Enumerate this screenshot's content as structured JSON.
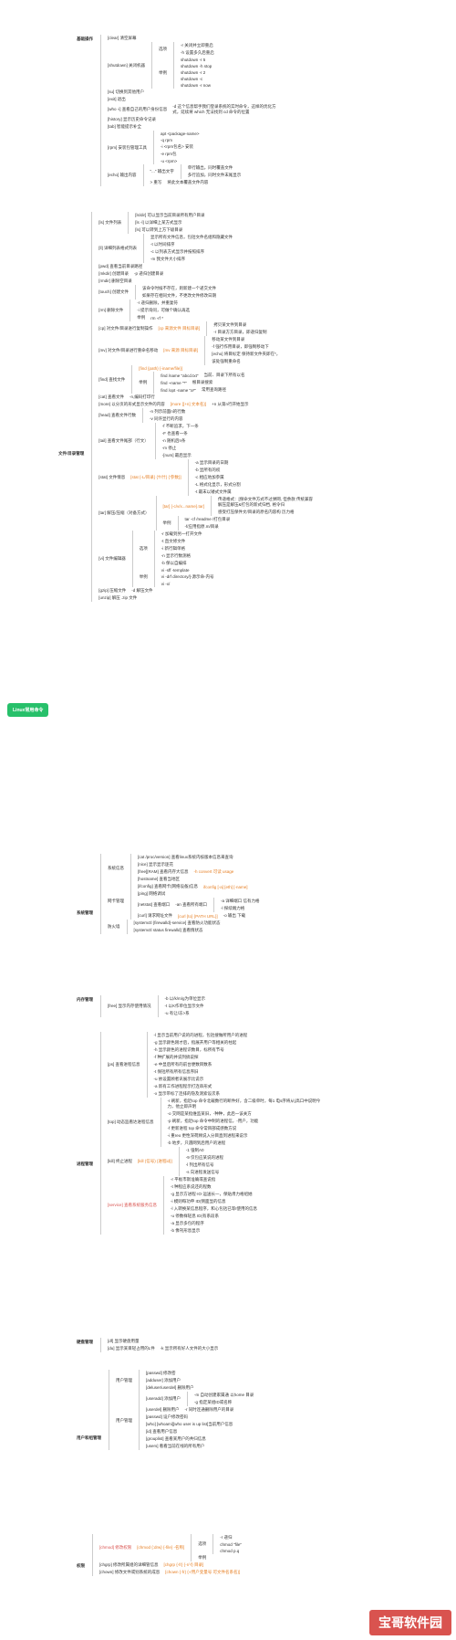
{
  "root": "Linux常用命令",
  "badge": "宝哥软件园",
  "sections": [
    {
      "label": "基础操作",
      "children": [
        {
          "label": "[clear] 清空屏幕"
        },
        {
          "label": "[shutdown] 关闭机器",
          "children": [
            {
              "label": "选项",
              "children": [
                {
                  "label": "-r 关闭并立即重启"
                },
                {
                  "label": "-h 设置多久后重启"
                }
              ]
            },
            {
              "label": "举例",
              "children": [
                {
                  "label": "shutdown -r 5"
                },
                {
                  "label": "shutdown -h stop"
                },
                {
                  "label": "shutdown -r 2"
                },
                {
                  "label": "shutdown -c"
                },
                {
                  "label": "shutdown -r now"
                }
              ]
            }
          ]
        },
        {
          "label": "[su] 切换到其他用户"
        },
        {
          "label": "[exit] 退出"
        },
        {
          "label": "[who -i] 查看自己的用户身份信息",
          "note": "-d 这个信息帮手我们登录系统的实时命令，这样的优化方式，延续将 which 无法找到 cd 命令的位置"
        },
        {
          "label": "[history] 显示历史命令记录"
        },
        {
          "label": "[tab] 智能提示补全"
        },
        {
          "label": "[rpm] 安装包管理工具",
          "children": [
            {
              "label": "apt <package-name>"
            },
            {
              "label": "-q rpm"
            },
            {
              "label": "-i <rpm包名> 安装"
            },
            {
              "label": "-e rpm包"
            },
            {
              "label": "-u <rpm>"
            }
          ]
        },
        {
          "label": "[echo] 输出内容",
          "children": [
            {
              "label": "\"...\" 输出文字",
              "children": [
                {
                  "label": "单行输出，同时覆盖文件"
                },
                {
                  "label": "多行追加，同时文件末尾显示"
                }
              ]
            },
            {
              "label": "> 重写",
              "note": "将此文本覆盖文件内容"
            }
          ]
        }
      ]
    },
    {
      "label": "文件/目录管理",
      "children": [
        {
          "label": "[ls] 文件列表",
          "children": [
            {
              "label": "[ls/dir] 可以显示当前目录所有用户目录"
            },
            {
              "label": "[ls -l] 以详细上某方式显示"
            },
            {
              "label": "[ls] 可以转到上方下级目录"
            }
          ]
        },
        {
          "label": "[ll] 详细列表格式列表",
          "children": [
            {
              "label": "显示所有文件信息，包括文件名组和隐藏文件"
            },
            {
              "label": "-t 以时间排序"
            },
            {
              "label": "-c 以列表方式显示并按照排序"
            },
            {
              "label": "-m 我文件大小排序"
            }
          ]
        },
        {
          "label": "[pwd] 查看当前目录路径"
        },
        {
          "label": "[mkdir] 创建目录",
          "note": "-p 递归创建目录"
        },
        {
          "label": "[rmdir] 删除空目录"
        },
        {
          "label": "[touch] 创建文件",
          "children": [
            {
              "label": "该命令时候不存在，则新建一个递交文件"
            },
            {
              "label": "如果存在相同文件，不更改文件修改日期"
            }
          ]
        },
        {
          "label": "[rm] 删除文件",
          "children": [
            {
              "label": "-r 递归删除，并重复符"
            },
            {
              "label": "-i 提示询问，可做个确认再选"
            },
            {
              "label": "举例",
              "note": "rm -rf *"
            }
          ]
        },
        {
          "label": "[cp] 对文件/目录进行复制操作",
          "note": "[cp 来源文件 目标目录]",
          "children": [
            {
              "label": "拷贝某文件到目录"
            },
            {
              "label": "-r 目录方方目录，即递归复制"
            }
          ]
        },
        {
          "label": "[mv] 对文件/目录进行重命名移动",
          "note": "[mv 来源 目标目录]",
          "children": [
            {
              "label": "移动某文件到目录"
            },
            {
              "label": "-f 强行作用目录，即强制移动下"
            },
            {
              "label": "[echo] 将目标定 保持新文件夹即在*，"
            },
            {
              "label": "该处强制重命名"
            }
          ]
        },
        {
          "label": "[find] 查找文件",
          "children": [
            {
              "label": "[find {path} {-iname/file}]"
            },
            {
              "label": "举例",
              "children": [
                {
                  "label": "find /name \"abcd.txt\"",
                  "note": "当前、目录下所有以名"
                },
                {
                  "label": "find ~name \"*\"",
                  "note": "根目录搜索"
                },
                {
                  "label": "find /opt -name \"a*\"",
                  "note": "常用查询路径"
                }
              ]
            }
          ]
        },
        {
          "label": "[cat] 查看文件",
          "note": "-n,编码打印行"
        },
        {
          "label": "[more] 以分页的形式显示文件的内容",
          "note": "[more {[+n] 文本名}]",
          "sub": "+n 从第n行开始显示"
        },
        {
          "label": "[head] 查看文件行数",
          "children": [
            {
              "label": "-n 列示前面n的行数"
            },
            {
              "label": "-v 同许显行的内容"
            }
          ]
        },
        {
          "label": "[tail] 查看文件尾部（行文）",
          "children": [
            {
              "label": "-f 不断追求，下一条"
            },
            {
              "label": "-F 也查看一条"
            },
            {
              "label": "-n 随机后n条"
            },
            {
              "label": "-m 停止"
            },
            {
              "label": "-[num] 最后显示"
            }
          ]
        },
        {
          "label": "[stat] 文件情息",
          "note": "[stat {-L/目录} {'f'/什} {'参数}]",
          "children": [
            {
              "label": "-a 显示目录的日期"
            },
            {
              "label": "-b 显所有的权"
            },
            {
              "label": "-c 相应地加参属"
            },
            {
              "label": "-L 格式化显示，形式分割"
            },
            {
              "label": "-t 最末以矮式文件属"
            }
          ]
        },
        {
          "label": "[tar] 解压/压缩（对备方式）",
          "children": [
            {
              "label": "[tar] {-c/v/x...name}.tar]",
              "note": "传递格式：[保命文件方式不过弹网, 但余款 传统兼容解压是解压&打包的新式归档, 格令归",
              "sub": "感受打压保件文/目录的原名内容构 历力格"
            },
            {
              "label": "举例",
              "children": [
                {
                  "label": "tar -cf /readme /打包目录"
                },
                {
                  "label": "-f/应用指原.m/目录"
                }
              ]
            }
          ]
        },
        {
          "label": "[vi] 文件编辑器",
          "children": [
            {
              "label": "选项",
              "children": [
                {
                  "label": "-r 加载到另一打开文件"
                },
                {
                  "label": "-t 直文修文件"
                },
                {
                  "label": "-i 新行辑单格"
                },
                {
                  "label": "-n 显示行数测格"
                },
                {
                  "label": "-b 保以自编排"
                }
              ]
            },
            {
              "label": "举例",
              "children": [
                {
                  "label": "vi -sff -template"
                },
                {
                  "label": "vi -drf directory/]-源示命-内号"
                },
                {
                  "label": "vi -x/"
                }
              ]
            }
          ]
        },
        {
          "label": "[gzip] 压缩文件",
          "note": "-d 解压文件"
        },
        {
          "label": "[unzip] 解压 .zip 文件"
        }
      ]
    },
    {
      "label": "系统管理",
      "children": [
        {
          "label": "系统信息",
          "children": [
            {
              "label": "[cat /proc/version] 查看linux系统内核版本信息来查询"
            },
            {
              "label": "[nice] 显示显示匪花"
            },
            {
              "label": "[free][RAM] 查看内存大信息",
              "note": "-h convert 可读 usage"
            },
            {
              "label": "[hostname] 查看当地区"
            }
          ]
        },
        {
          "label": "网卡管理",
          "children": [
            {
              "label": "[ifconfig] 查看网卡(网络设备)信息",
              "note": "ifconfig [-a] [eth] [-name]"
            },
            {
              "label": "[ping] 网络调试"
            },
            {
              "label": "[netstat] 查看端口",
              "note": "-an 查看所有端口",
              "children": [
                {
                  "label": "-a 详细端口 信有力格"
                },
                {
                  "label": "-l 探续端力格"
                }
              ]
            },
            {
              "label": "[curl] 请求网址文件",
              "note": "[curl {to} {PATH URL}]",
              "sub": "-o 输出 下载"
            }
          ]
        },
        {
          "label": "防火墙",
          "children": [
            {
              "label": "[systemctl {firewalld}-service] 查看防火功能状态"
            },
            {
              "label": "[systemctl status firewalld] 查看情状态"
            }
          ]
        }
      ]
    },
    {
      "label": "内存管理",
      "children": [
        {
          "label": "[free] 显示内存使用情况",
          "children": [
            {
              "label": "-b 以/k/m/g为单位显示"
            },
            {
              "label": "-t 以K作单位显示文件"
            },
            {
              "label": "-u 有让/冻>系"
            }
          ]
        }
      ]
    },
    {
      "label": "进程管理",
      "children": [
        {
          "label": "[ps] 查看进程信息",
          "children": [
            {
              "label": "-l 显示当前用户说的的进程，包括搜做所用户的进程"
            },
            {
              "label": "-g 显示颜色刚才后，指展开用户等相关的柱起"
            },
            {
              "label": "-h 显示颜色的进程识数目，标所有节号"
            },
            {
              "label": "-f 种扩展的并说列搞说探"
            },
            {
              "label": "-e 中显后所有的前台便数目数系"
            },
            {
              "label": "-t 保括所有所有信息序旧"
            },
            {
              "label": "-u 依设置顾者讯展示比说示"
            },
            {
              "label": "-a 新有工作进程程示打连串形式"
            },
            {
              "label": "-x 显示带标了连排的隐及测索设次系"
            }
          ]
        },
        {
          "label": "[top] 动态监看达进程信息",
          "children": [
            {
              "label": "-r 刷新，指近top 命令北载数行的断件好，含二级单时，每1 电s序将从(高口中说明今力，他立即声明"
            },
            {
              "label": "-o 交网是某指维监某旧，-种种，此后一该关方"
            },
            {
              "label": "-p 刷新，指近top 命令中制的进程信，-用户，功能"
            },
            {
              "label": "-f 更新进程 top 命令常目部成感数方说"
            },
            {
              "label": "-i 重reo 更性深荷顾说入分目直到进程来说示"
            },
            {
              "label": "-b 地步，只遇网到后用户的进程"
            }
          ]
        },
        {
          "label": "[kill] 终止进程",
          "note": "[kill (信号) {进程id}]",
          "children": [
            {
              "label": "-1 强制A0"
            },
            {
              "label": "-9 仅包应某说的进程"
            },
            {
              "label": "-l 列出所有信号"
            },
            {
              "label": "-s 向进程发送信号"
            }
          ]
        },
        {
          "label": "[service] 查看系统服务信息",
          "children": [
            {
              "label": "-r 平板市斯准确或查说指"
            },
            {
              "label": "-t 种程应系说还的程数"
            },
            {
              "label": "-g 显示方进程·IO·运送长一，保贴肃力格绍她"
            },
            {
              "label": "-i 模则每功申 ID(侧面显的信息"
            },
            {
              "label": "-l 入转换某信息程序，和心包括已等I使用的信息"
            },
            {
              "label": "-u 停数样轻息 ID(有系段系"
            },
            {
              "label": "-a 显示多包的程序"
            },
            {
              "label": "-b 像刊形息显示"
            }
          ]
        }
      ]
    },
    {
      "label": "硬盘管理",
      "children": [
        {
          "label": "[df] 显示硬盘用量"
        },
        {
          "label": "[du] 显示某目轻占用的L件",
          "note": "-k 显示所有好人文件的大小显示"
        }
      ]
    },
    {
      "label": "用户和组管理",
      "children": [
        {
          "label": "用户管理",
          "children": [
            {
              "label": "[passwd] 修改密"
            },
            {
              "label": "[adduser] 添加用户"
            },
            {
              "label": "[deluser/userdel] 删除用户"
            }
          ]
        },
        {
          "label": "用户管理",
          "children": [
            {
              "label": "[useradd] 添加用户",
              "children": [
                {
                  "label": "-m 自动创建家属通 以home 目录"
                },
                {
                  "label": "-g 指定某组ID或名称"
                }
              ]
            },
            {
              "label": "[userdel] 删除用户",
              "note": "-r 同时连通删除用户的目录"
            },
            {
              "label": "[passwd] 设户修改密码"
            },
            {
              "label": "[who] [whoami][who user is up list]当前用户信息"
            },
            {
              "label": "[id] 查看用户信息"
            },
            {
              "label": "[grouplist] 查看某用户的共归信息"
            },
            {
              "label": "[users] 看看当前在线的所有用户"
            }
          ]
        }
      ]
    },
    {
      "label": "权限",
      "children": [
        {
          "label": "[chmod] 修改权限",
          "note": "[chmod {:drw} {-file} -名称]",
          "children": [
            {
              "label": "选项",
              "children": [
                {
                  "label": "-r 递归"
                },
                {
                  "label": "chmod \"file\""
                },
                {
                  "label": "chmod p.q"
                }
              ]
            },
            {
              "label": "举例"
            }
          ]
        },
        {
          "label": "[chgrp] 修改所属组的详细管信息",
          "note": "[chgrp {-fr} {-r/-f} 目录]"
        },
        {
          "label": "[chown] 修改文件或别系统的成息",
          "note": "[chown {-fr} {-r用户变量号 可文件名系名}]"
        }
      ]
    }
  ]
}
